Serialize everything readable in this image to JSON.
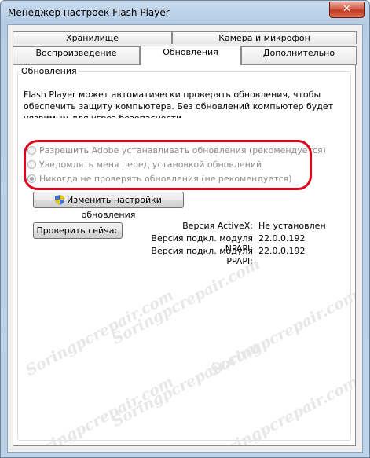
{
  "window": {
    "title": "Менеджер настроек Flash Player",
    "close_label": "✕"
  },
  "tabs": {
    "row_top": [
      "Хранилище",
      "Камера и микрофон"
    ],
    "row_bottom": [
      "Воспроизведение",
      "Обновления",
      "Дополнительно"
    ],
    "active": "Обновления"
  },
  "updates": {
    "group_label": "Обновления",
    "description": "Flash Player может автоматически проверять обновления, чтобы обеспечить защиту компьютера. Без обновлений компьютер будет уязвимым для угроз безопасности.",
    "options": [
      {
        "label": "Разрешить Adobe устанавливать обновления (рекомендуется)",
        "checked": false
      },
      {
        "label": "Уведомлять меня перед установкой обновлений",
        "checked": false
      },
      {
        "label": "Никогда не проверять обновления (не рекомендуется)",
        "checked": true
      }
    ],
    "highlight_color": "#e3001b",
    "change_settings_button": "Изменить настройки обновления",
    "check_now_button": "Проверить сейчас",
    "versions": [
      {
        "label": "Версия ActiveX:",
        "value": "Не установлен"
      },
      {
        "label": "Версия подкл. модуля NPAPI:",
        "value": "22.0.0.192"
      },
      {
        "label": "Версия подкл. модуля PPAPI:",
        "value": "22.0.0.192"
      }
    ]
  },
  "watermark": "Soringpcrepair.com"
}
